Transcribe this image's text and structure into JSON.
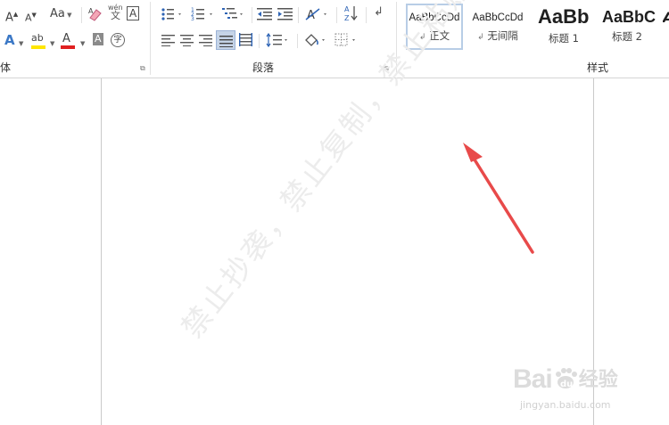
{
  "ribbon": {
    "font_group": {
      "label_fragment": "体",
      "grow_font": "A",
      "shrink_font": "A",
      "change_case": "Aa",
      "pinyin_top": "wén",
      "pinyin_bottom": "文",
      "char_border": "A",
      "text_effects": "A",
      "highlight": "ab",
      "font_color": "A",
      "char_shading": "A",
      "enclose": "字",
      "highlight_color": "#ffe600",
      "font_color_value": "#e02020"
    },
    "paragraph_group": {
      "label": "段落"
    },
    "styles_group": {
      "label": "样式",
      "items": [
        {
          "sample": "AaBbCcDd",
          "name": "正文",
          "marker": "↲",
          "selected": true
        },
        {
          "sample": "AaBbCcDd",
          "name": "无间隔",
          "marker": "↲",
          "selected": false
        },
        {
          "sample": "AaBb",
          "name": "标题 1",
          "selected": false
        },
        {
          "sample": "AaBbC",
          "name": "标题 2",
          "selected": false
        },
        {
          "sample": "A",
          "name": "",
          "selected": false
        }
      ]
    }
  },
  "document": {
    "watermark": "禁止抄袭，禁止复制，禁止粘贴",
    "annotation_arrow_color": "#e84a4a"
  },
  "brand": {
    "logo_text": "Bai",
    "logo_text2": "du",
    "logo_cn": "经验",
    "url": "jingyan.baidu.com"
  }
}
